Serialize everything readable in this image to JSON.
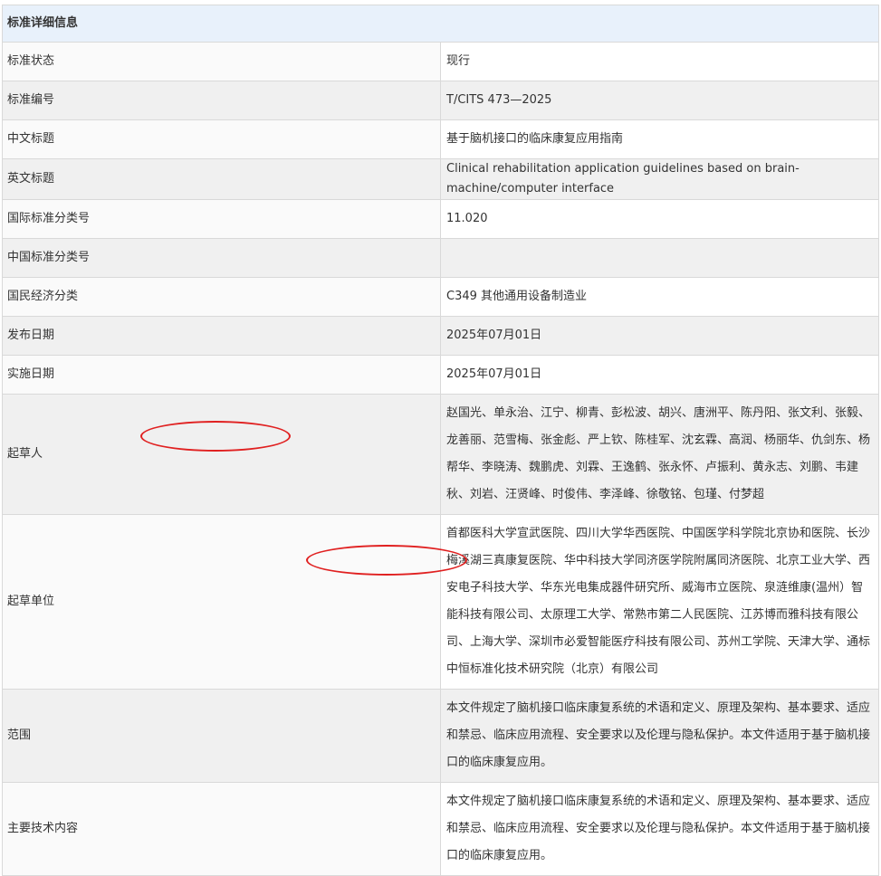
{
  "header": {
    "title": "标准详细信息"
  },
  "rows": {
    "status": {
      "label": "标准状态",
      "value": "现行"
    },
    "code": {
      "label": "标准编号",
      "value": "T/CITS 473—2025"
    },
    "cn_title": {
      "label": "中文标题",
      "value": "基于脑机接口的临床康复应用指南"
    },
    "en_title": {
      "label": "英文标题",
      "value": "Clinical rehabilitation application guidelines based on brain-machine/computer interface"
    },
    "ics": {
      "label": "国际标准分类号",
      "value": "11.020"
    },
    "ccs": {
      "label": "中国标准分类号",
      "value": ""
    },
    "economy": {
      "label": "国民经济分类",
      "value": "C349 其他通用设备制造业"
    },
    "publish": {
      "label": "发布日期",
      "value": "2025年07月01日"
    },
    "effective": {
      "label": "实施日期",
      "value": "2025年07月01日"
    },
    "drafters": {
      "label": "起草人",
      "value": "赵国光、单永治、江宁、柳青、彭松波、胡兴、唐洲平、陈丹阳、张文利、张毅、龙善丽、范雪梅、张金彪、严上钦、陈桂军、沈玄霖、高润、杨丽华、仇剑东、杨帮华、李晓涛、魏鹏虎、刘霖、王逸鹤、张永怀、卢振利、黄永志、刘鹏、韦建秋、刘岩、汪贤峰、时俊伟、李泽峰、徐敬铭、包瑾、付梦超"
    },
    "units": {
      "label": "起草单位",
      "value": "首都医科大学宣武医院、四川大学华西医院、中国医学科学院北京协和医院、长沙梅溪湖三真康复医院、华中科技大学同济医学院附属同济医院、北京工业大学、西安电子科技大学、华东光电集成器件研究所、威海市立医院、泉涟维康(温州）智能科技有限公司、太原理工大学、常熟市第二人民医院、江苏博而雅科技有限公司、上海大学、深圳市必爱智能医疗科技有限公司、苏州工学院、天津大学、通标中恒标准化技术研究院（北京）有限公司"
    },
    "scope": {
      "label": "范围",
      "value": "本文件规定了脑机接口临床康复系统的术语和定义、原理及架构、基本要求、适应和禁忌、临床应用流程、安全要求以及伦理与隐私保护。本文件适用于基于脑机接口的临床康复应用。"
    },
    "tech": {
      "label": "主要技术内容",
      "value": "本文件规定了脑机接口临床康复系统的术语和定义、原理及架构、基本要求、适应和禁忌、临床应用流程、安全要求以及伦理与隐私保护。本文件适用于基于脑机接口的临床康复应用。"
    }
  },
  "colors": {
    "header_bg": "#e8f1fb",
    "alt_row_bg": "#f0f0f0",
    "border": "#d9d9d9",
    "highlight": "#e02020"
  }
}
